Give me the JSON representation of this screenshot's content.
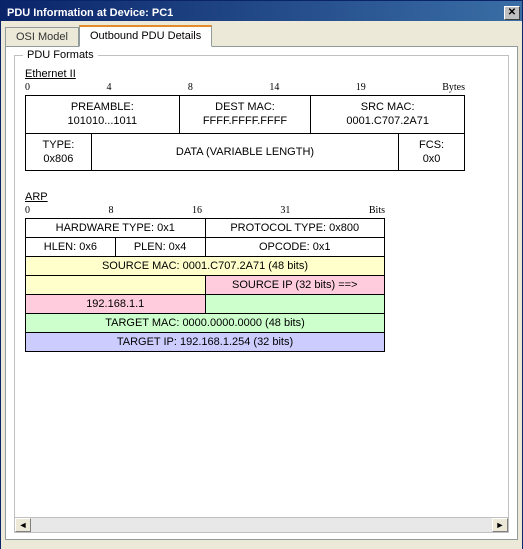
{
  "window": {
    "title": "PDU Information at Device: PC1"
  },
  "tabs": {
    "osi": "OSI Model",
    "outbound": "Outbound PDU Details"
  },
  "fieldset": {
    "legend": "PDU Formats"
  },
  "ethernet": {
    "title": "Ethernet II",
    "ruler": {
      "c0": "0",
      "c1": "4",
      "c2": "8",
      "c3": "14",
      "c4": "19",
      "unit": "Bytes"
    },
    "preamble": {
      "label": "PREAMBLE:",
      "value": "101010...1011"
    },
    "destmac": {
      "label": "DEST MAC:",
      "value": "FFFF.FFFF.FFFF"
    },
    "srcmac": {
      "label": "SRC MAC:",
      "value": "0001.C707.2A71"
    },
    "type": {
      "label": "TYPE:",
      "value": "0x806"
    },
    "data": {
      "label": "DATA (VARIABLE LENGTH)"
    },
    "fcs": {
      "label": "FCS:",
      "value": "0x0"
    }
  },
  "arp": {
    "title": "ARP",
    "ruler": {
      "c0": "0",
      "c1": "8",
      "c2": "16",
      "c3": "31",
      "unit": "Bits"
    },
    "hwtype": "HARDWARE TYPE: 0x1",
    "prototype": "PROTOCOL TYPE: 0x800",
    "hlen": "HLEN: 0x6",
    "plen": "PLEN: 0x4",
    "opcode": "OPCODE: 0x1",
    "srcmac": "SOURCE MAC: 0001.C707.2A71 (48 bits)",
    "srcip_label": "SOURCE IP (32 bits) ==>",
    "srcip_value": "192.168.1.1",
    "tgtmac": "TARGET MAC: 0000.0000.0000 (48 bits)",
    "tgtip": "TARGET IP: 192.168.1.254 (32 bits)"
  },
  "scroll": {
    "left": "◄",
    "right": "►"
  }
}
